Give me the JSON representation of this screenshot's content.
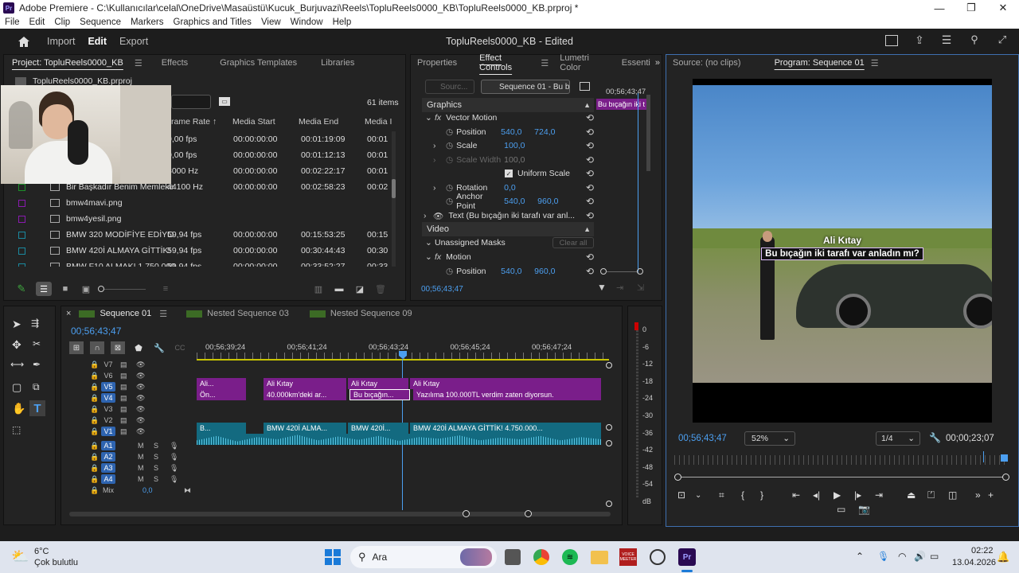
{
  "window": {
    "title": "Adobe Premiere - C:\\Kullanıcılar\\celal\\OneDrive\\Masaüstü\\Kucuk_Burjuvazi\\Reels\\TopluReels0000_KB\\TopluReels0000_KB.prproj *",
    "icon": "Pr"
  },
  "menu": [
    "File",
    "Edit",
    "Clip",
    "Sequence",
    "Markers",
    "Graphics and Titles",
    "View",
    "Window",
    "Help"
  ],
  "header": {
    "import": "Import",
    "edit": "Edit",
    "export": "Export",
    "project_title": "TopluReels0000_KB - Edited"
  },
  "project": {
    "tabs": [
      "Project: TopluReels0000_KB",
      "Effects",
      "Graphics Templates",
      "Libraries"
    ],
    "file": "TopluReels0000_KB.prproj",
    "item_count": "61 items",
    "columns": [
      "rame Rate",
      "Media Start",
      "Media End",
      "Media I"
    ],
    "rows": [
      {
        "name": "",
        "rate": "0,00 fps",
        "start": "00:00:00:00",
        "end": "00:01:19:09",
        "dur": "00:01",
        "color": "#8f8f8f"
      },
      {
        "name": "",
        "rate": "0,00 fps",
        "start": "00:00:00:00",
        "end": "00:01:12:13",
        "dur": "00:01",
        "color": "#8f8f8f"
      },
      {
        "name": "",
        "rate": "8000 Hz",
        "start": "00:00:00:00",
        "end": "00:02:22:17",
        "dur": "00:01",
        "color": "#8f8f8f"
      },
      {
        "name": "Bir Başkadır Benim Memleke",
        "rate": "44100 Hz",
        "start": "00:00:00:00",
        "end": "00:02:58:23",
        "dur": "00:02",
        "color": "#1d8e2a"
      },
      {
        "name": "bmw4mavi.png",
        "rate": "",
        "start": "",
        "end": "",
        "dur": "",
        "color": "#8a1ab0"
      },
      {
        "name": "bmw4yesil.png",
        "rate": "",
        "start": "",
        "end": "",
        "dur": "",
        "color": "#8a1ab0"
      },
      {
        "name": "BMW 320 MODİFİYE EDİYO",
        "rate": "59,94 fps",
        "start": "00:00:00:00",
        "end": "00:15:53:25",
        "dur": "00:15",
        "color": "#1a8aa0"
      },
      {
        "name": "BMW 420İ ALMAYA GİTTİK!",
        "rate": "59,94 fps",
        "start": "00:00:00:00",
        "end": "00:30:44:43",
        "dur": "00:30",
        "color": "#1a8aa0"
      },
      {
        "name": "BMW F10 ALMAK! 1.750.000",
        "rate": "59,94 fps",
        "start": "00:00:00:00",
        "end": "00:33:52:27",
        "dur": "00:33",
        "color": "#1a8aa0"
      }
    ]
  },
  "effect_controls": {
    "tabs": [
      "Properties",
      "Effect Controls",
      "Lumetri Color",
      "Essenti"
    ],
    "source_btn": "Sourc...",
    "sequence_btn": "Sequence 01 - Bu b...",
    "mini_timecode": "00;56;43;47",
    "mini_clip": "Bu bıçağın iki t",
    "graphics_label": "Graphics",
    "vector_motion": "Vector Motion",
    "position_label": "Position",
    "position_x": "540,0",
    "position_y": "724,0",
    "scale_label": "Scale",
    "scale_value": "100,0",
    "scale_width_label": "Scale Width",
    "scale_width_value": "100,0",
    "uniform_scale": "Uniform Scale",
    "rotation_label": "Rotation",
    "rotation_value": "0,0",
    "anchor_label": "Anchor Point",
    "anchor_x": "540,0",
    "anchor_y": "960,0",
    "text_layer": "Text (Bu bıçağın iki tarafı var anl...",
    "video_label": "Video",
    "unassigned_masks": "Unassigned Masks",
    "clear_all": "Clear all",
    "motion_label": "Motion",
    "position2_label": "Position",
    "position2_x": "540,0",
    "position2_y": "960,0",
    "timecode": "00;56;43;47"
  },
  "program": {
    "source_tab": "Source: (no clips)",
    "program_tab": "Program: Sequence 01",
    "overlay_name": "Ali Kıtay",
    "overlay_subtitle": "Bu bıçağın iki tarafı var anladın mı?",
    "timecode": "00;56;43;47",
    "zoom": "52%",
    "resolution": "1/4",
    "duration": "00;00;23;07"
  },
  "timeline": {
    "tabs": [
      "Sequence 01",
      "Nested Sequence 03",
      "Nested Sequence 09"
    ],
    "timecode": "00;56;43;47",
    "ruler": [
      "00;56;39;24",
      "00;56;41;24",
      "00;56;43;24",
      "00;56;45;24",
      "00;56;47;24"
    ],
    "tracks": [
      "V7",
      "V6",
      "V5",
      "V4",
      "V3",
      "V2",
      "V1",
      "A1",
      "A2",
      "A3",
      "A4"
    ],
    "mix_label": "Mix",
    "mix_value": "0,0",
    "v5_clips": [
      "Ali...",
      "Ali Kıtay",
      "Ali Kıtay",
      "Ali Kıtay"
    ],
    "v4_clips": [
      "Ön...",
      "40.000km'deki ar...",
      "Bu bıçağın...",
      "Yazılıma 100.000TL verdim zaten diyorsun."
    ],
    "v1_clips": [
      "B...",
      "BMW 420İ ALMA...",
      "BMW 420İ...",
      "BMW 420İ ALMAYA GİTTİK! 4.750.000..."
    ]
  },
  "meter": {
    "scale": [
      "0",
      "-6",
      "-12",
      "-18",
      "-24",
      "-30",
      "-36",
      "-42",
      "-48",
      "-54",
      "dB"
    ]
  },
  "taskbar": {
    "temp": "6°C",
    "weather": "Çok bulutlu",
    "search": "Ara",
    "time": "02:22",
    "date": "13.04.2026",
    "voicemeeter": "VOICE MEETER"
  }
}
